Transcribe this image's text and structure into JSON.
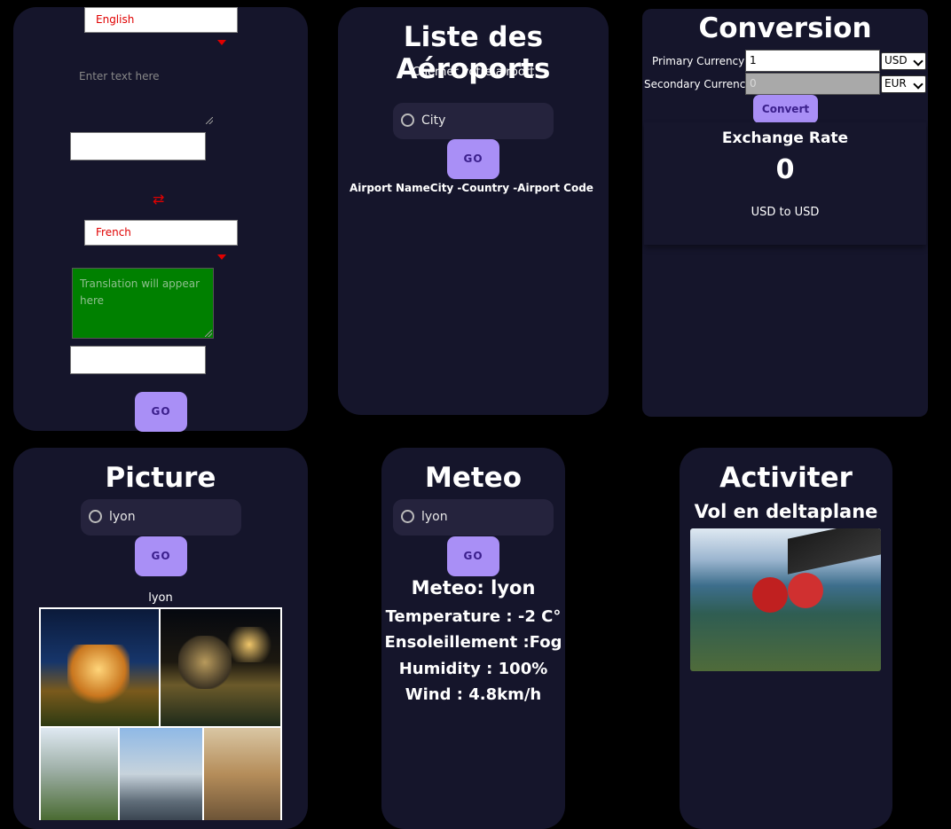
{
  "translator": {
    "source_language": "English",
    "source_placeholder": "Enter text here",
    "target_language": "French",
    "target_placeholder": "Translation will appear here",
    "go_label": "GO",
    "swap_icon": "swap-arrows-icon",
    "colors": {
      "accent": "#e00000",
      "output_bg": "#008000",
      "button": "#a98ff6"
    }
  },
  "airports": {
    "title": "Liste des Aéroports",
    "subtitle": "Cherher votre airport",
    "search_placeholder": "City",
    "go_label": "GO",
    "result_header": "Airport NameCity -Country -Airport Code"
  },
  "conversion": {
    "title": "Conversion",
    "primary_label": "Primary Currency",
    "primary_value": "1",
    "primary_currency": "USD",
    "secondary_label": "Secondary Currency",
    "secondary_value": "0",
    "secondary_currency": "EUR",
    "convert_label": "Convert",
    "rate_title": "Exchange Rate",
    "rate_value": "0",
    "rate_pair": "USD to USD"
  },
  "picture": {
    "title": "Picture",
    "search_value": "lyon",
    "go_label": "GO",
    "caption": "lyon"
  },
  "meteo": {
    "title": "Meteo",
    "search_value": "lyon",
    "go_label": "GO",
    "heading": "Meteo: lyon",
    "temperature": "Temperature : -2 C°",
    "sunshine": "Ensoleillement :Fog",
    "humidity": "Humidity : 100%",
    "wind": "Wind : 4.8km/h"
  },
  "activiter": {
    "title": "Activiter",
    "activity": "Vol en deltaplane"
  }
}
